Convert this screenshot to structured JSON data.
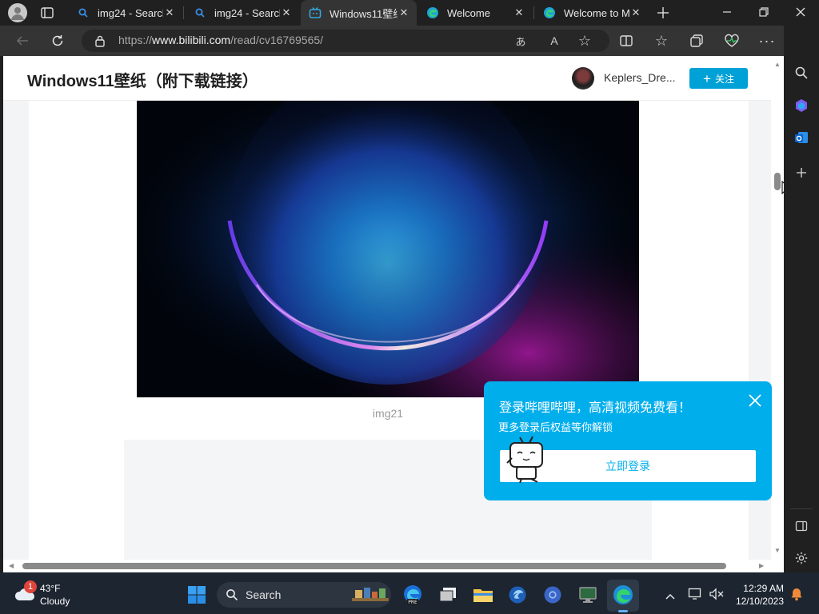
{
  "tabs": [
    {
      "title": "img24 - Search",
      "icon": "search-favicon"
    },
    {
      "title": "img24 - Search",
      "icon": "search-favicon"
    },
    {
      "title": "Windows11壁纸",
      "icon": "bilibili-favicon"
    },
    {
      "title": "Welcome",
      "icon": "edge-favicon"
    },
    {
      "title": "Welcome to M",
      "icon": "edge-favicon"
    }
  ],
  "address": {
    "prefix": "https://",
    "host": "www.bilibili.com",
    "path": "/read/cv16769565/"
  },
  "article": {
    "title": "Windows11壁纸（附下载链接）",
    "author": "Keplers_Dre...",
    "follow_label": "关注",
    "image_caption": "img21"
  },
  "login_popup": {
    "title": "登录哔哩哔哩，高清视频免费看！",
    "subtitle": "更多登录后权益等你解锁",
    "button_label": "立即登录"
  },
  "taskbar": {
    "weather_temp": "43°F",
    "weather_desc": "Cloudy",
    "weather_badge": "1",
    "search_label": "Search",
    "time": "12:29 AM",
    "date": "12/10/2023"
  },
  "colors": {
    "bilibili_blue": "#00a1d6",
    "popup_blue": "#00aeec",
    "edge_chrome": "#343434"
  }
}
